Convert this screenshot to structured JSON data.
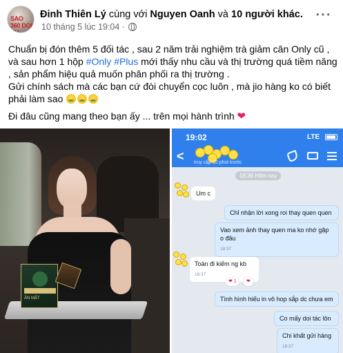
{
  "post": {
    "author": "Đinh Thiên Lý",
    "with_text": "cùng với",
    "tagged": "Nguyen Oanh",
    "and_text": "và",
    "others": "10 người khác.",
    "timestamp": "10 tháng 5 lúc 19:04",
    "separator": "·",
    "more_label": "···",
    "avatar_watermark": "SAO 360 DOI NU"
  },
  "caption": {
    "line1_a": "Chuẩn bị đón thêm 5 đối tác , sau 2 năm trải nghiệm trà giảm cân Only cũ , và sau hơn 1 hộp ",
    "hashtag1": "#Only",
    "space": " ",
    "hashtag2": "#Plus",
    "line1_b": " mới thấy nhu cầu và thị trường quá tiềm năng , sản phẩm hiệu quả muốn phân phối ra thị trường .",
    "line2": "Gửi chính sách  mà các bạn cứ đòi chuyển cọc luôn , mà jio hàng ko có biết phải làm sao",
    "line3": "Đi đâu cũng mang theo bạn ấy ... trên mọi hành trình",
    "heart": "❤"
  },
  "photo_left": {
    "product_name": "ĂN MẬT"
  },
  "phone": {
    "status_time": "19:02",
    "signal": "LTE",
    "contact_sub": "truy cập 10 phút trước",
    "date_pill": "18:36 Hôm nay",
    "messages": [
      {
        "text": "Um c",
        "time": ""
      },
      {
        "text": "Chỉ nhận lời xong roi thay quen quen",
        "time": ""
      },
      {
        "text": "Vao xem ảnh thay quen ma ko nhớ gặp o đâu",
        "time": "18:37"
      },
      {
        "text": "Toàn đi kiếm ng kb",
        "time": "18:37"
      },
      {
        "text": "Tình hình hiếu in vô hop sắp dc chưa em",
        "time": ""
      },
      {
        "text": "Co mấy doi tác lôn",
        "time": ""
      },
      {
        "text": "Chi khất gửi hàng",
        "time": "18:37"
      }
    ],
    "reaction_a": "❤ 1",
    "reaction_b": "❤"
  }
}
